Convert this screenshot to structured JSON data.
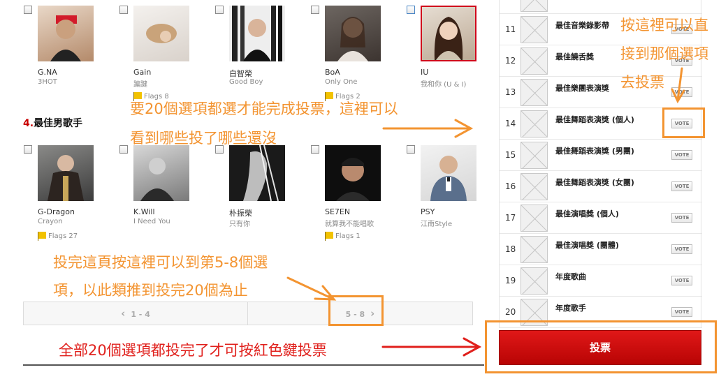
{
  "row1": [
    {
      "name": "G.NA",
      "song": "3HOT",
      "flags": ""
    },
    {
      "name": "Gain",
      "song": "蹁踺",
      "flags": "Flags 8"
    },
    {
      "name": "白智榮",
      "song": "Good Boy",
      "flags": ""
    },
    {
      "name": "BoA",
      "song": "Only One",
      "flags": "Flags 2"
    },
    {
      "name": "IU",
      "song": "我和你 (U & I)",
      "flags": ""
    }
  ],
  "section": {
    "number": "4.",
    "title": "最佳男歌手"
  },
  "row2": [
    {
      "name": "G-Dragon",
      "song": "Crayon",
      "flags": "Flags 27"
    },
    {
      "name": "K.Will",
      "song": "I Need You",
      "flags": ""
    },
    {
      "name": "朴振榮",
      "song": "只有你",
      "flags": ""
    },
    {
      "name": "SE7EN",
      "song": "就算我不能唱歌",
      "flags": "Flags 1"
    },
    {
      "name": "PSY",
      "song": "江南Style",
      "flags": ""
    }
  ],
  "pager": {
    "prev": "1 - 4",
    "next": "5 - 8"
  },
  "sidebar": {
    "vote_label": "VOTE",
    "rows": [
      {
        "num": "11",
        "label": "最佳音樂錄影帶"
      },
      {
        "num": "12",
        "label": "最佳饒舌獎"
      },
      {
        "num": "13",
        "label": "最佳樂團表演獎"
      },
      {
        "num": "14",
        "label": "最佳舞蹈表演獎 (個人)"
      },
      {
        "num": "15",
        "label": "最佳舞蹈表演獎 (男團)"
      },
      {
        "num": "16",
        "label": "最佳舞蹈表演獎 (女團)"
      },
      {
        "num": "17",
        "label": "最佳演唱獎 (個人)"
      },
      {
        "num": "18",
        "label": "最佳演唱獎 (團體)"
      },
      {
        "num": "19",
        "label": "年度歌曲"
      },
      {
        "num": "20",
        "label": "年度歌手"
      }
    ],
    "submit": "投票"
  },
  "annotations": {
    "a1_line1": "要20個選項都選才能完成投票，這裡可以",
    "a1_line2": "看到哪些投了哪些還沒",
    "a2_line1": "按這裡可以直",
    "a2_line2": "接到那個選項",
    "a2_line3": "去投票",
    "a3_line1": "投完這頁按這裡可以到第5-8個選",
    "a3_line2": "項，以此類推到投完20個為止",
    "a4": "全部20個選項都投完了才可按紅色鍵投票"
  },
  "colors": {
    "annotation": "#f39431",
    "annotation_red": "#e0201c",
    "vote_button": "#cc0a0a",
    "section_number": "#c80000"
  }
}
